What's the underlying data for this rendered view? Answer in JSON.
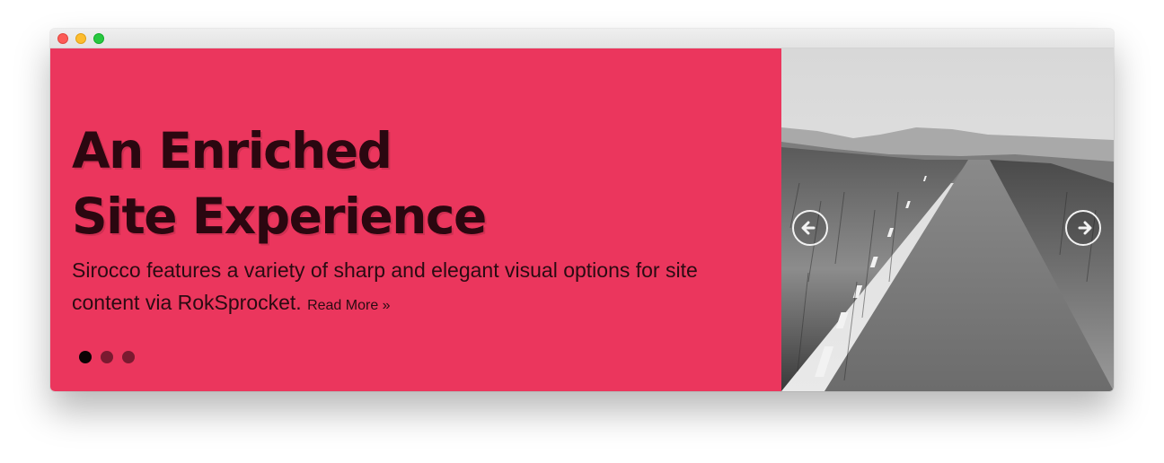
{
  "window": {
    "controls": [
      "close",
      "minimize",
      "maximize"
    ]
  },
  "slide": {
    "headline_line1": "An Enriched",
    "headline_line2": "Site Experience",
    "description": "Sirocco features a variety of sharp and elegant visual options for site content via RokSprocket.",
    "read_more_label": "Read More »",
    "dots": [
      {
        "active": true
      },
      {
        "active": false
      },
      {
        "active": false
      }
    ],
    "image_icon": "road-landscape-image",
    "prev_icon": "arrow-left-circle-icon",
    "next_icon": "arrow-right-circle-icon"
  },
  "colors": {
    "accent": "#eb365d",
    "headline": "#2b0710",
    "dot_active": "#0b0304",
    "dot_inactive": "#7a1a30"
  }
}
